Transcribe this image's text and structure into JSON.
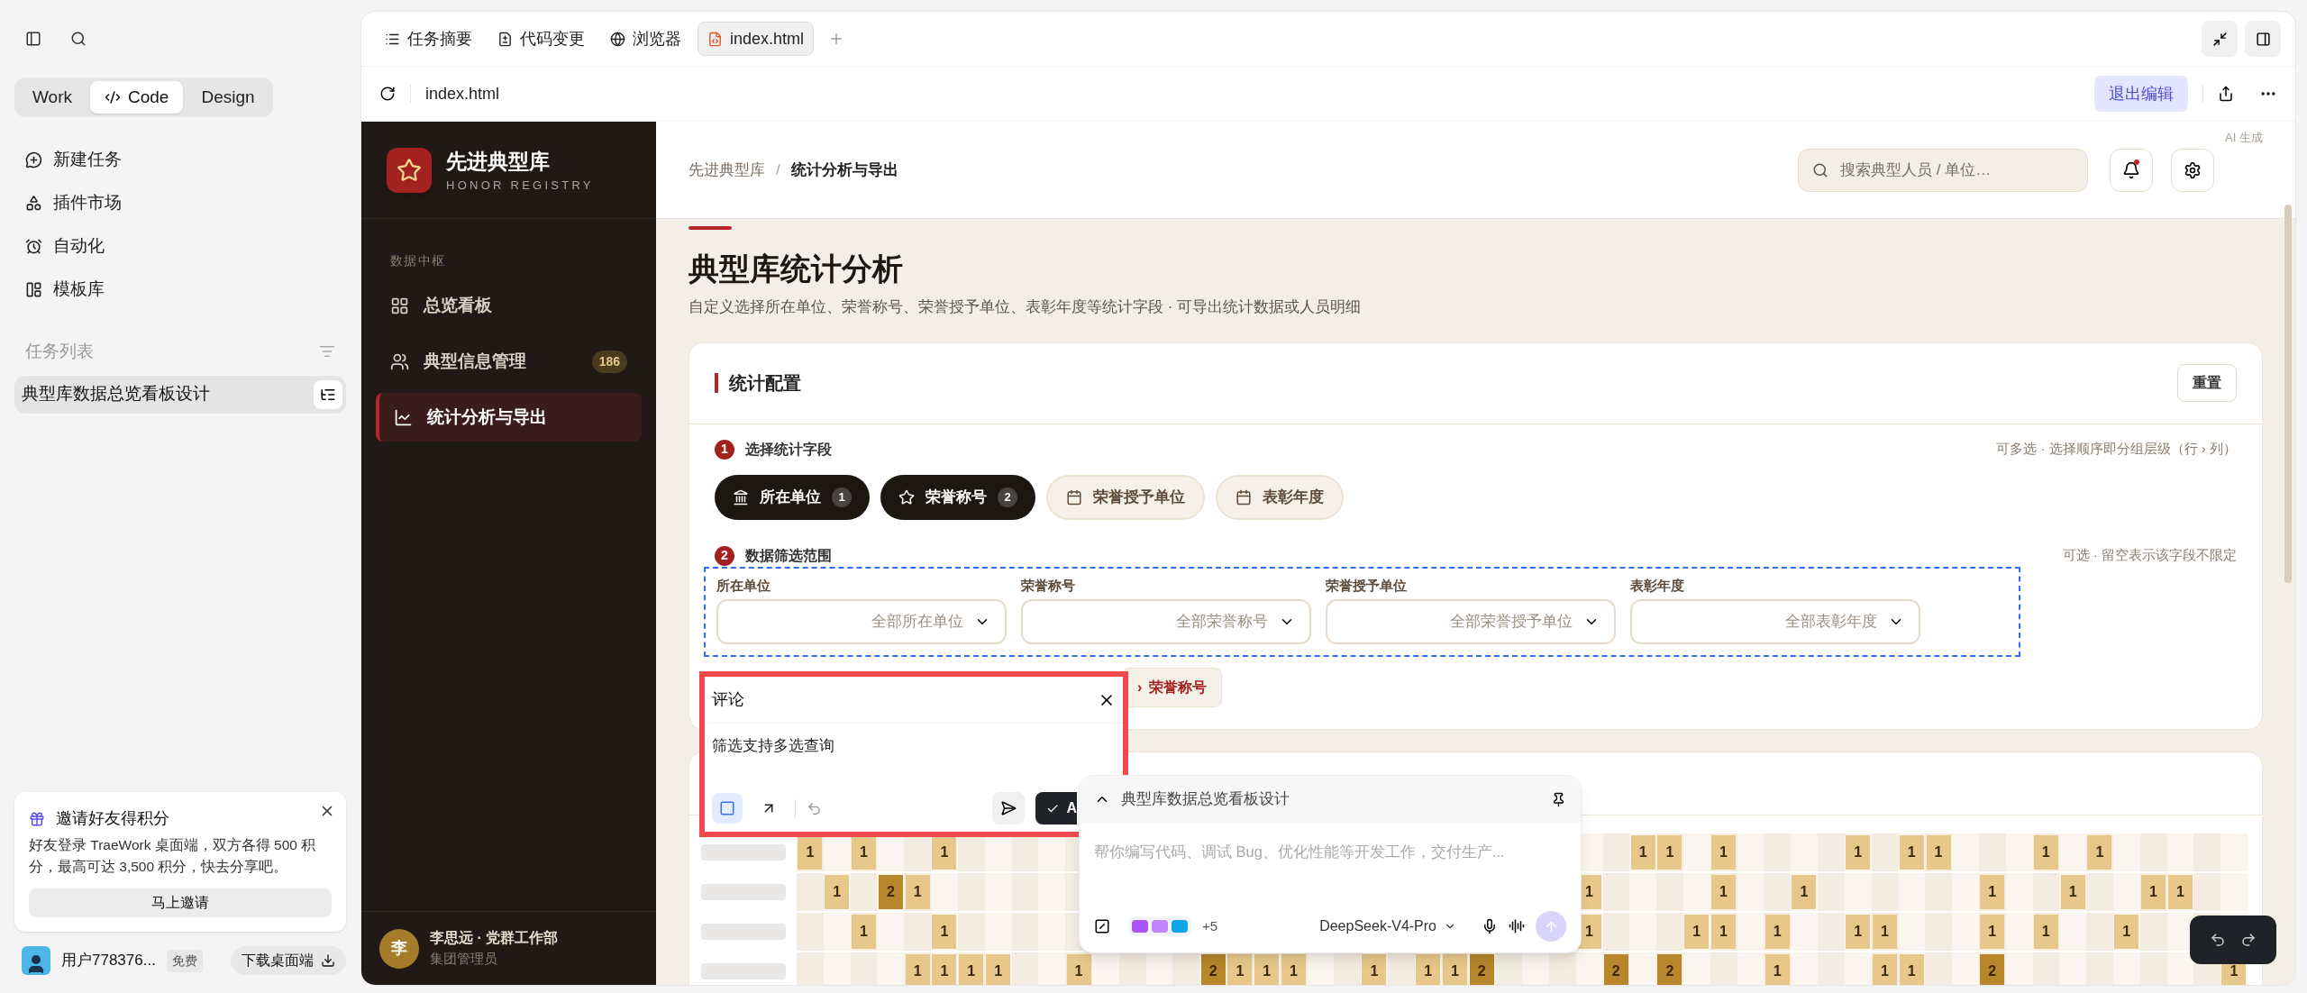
{
  "sidebar": {
    "modes": [
      {
        "label": "Work",
        "selected": false
      },
      {
        "label": "Code",
        "selected": true
      },
      {
        "label": "Design",
        "selected": false
      }
    ],
    "nav": [
      {
        "label": "新建任务"
      },
      {
        "label": "插件市场"
      },
      {
        "label": "自动化"
      },
      {
        "label": "模板库"
      }
    ],
    "task_list": {
      "title": "任务列表",
      "items": [
        {
          "label": "典型库数据总览看板设计",
          "selected": true
        }
      ]
    },
    "invite": {
      "title": "邀请好友得积分",
      "text": "好友登录 TraeWork 桌面端，双方各得 500 积分，最高可达 3,500 积分，快去分享吧。",
      "button": "马上邀请"
    },
    "user": {
      "name": "用户778376...",
      "plan": "免费",
      "download": "下载桌面端"
    }
  },
  "tabs": [
    {
      "label": "任务摘要",
      "selected": false
    },
    {
      "label": "代码变更",
      "selected": false
    },
    {
      "label": "浏览器",
      "selected": false
    },
    {
      "label": "index.html",
      "selected": true
    }
  ],
  "address": {
    "url": "index.html",
    "exit_button": "退出编辑"
  },
  "app": {
    "brand": {
      "name": "先进典型库",
      "subtitle": "HONOR REGISTRY"
    },
    "nav_section": "数据中枢",
    "nav": [
      {
        "label": "总览看板",
        "selected": false
      },
      {
        "label": "典型信息管理",
        "badge": "186",
        "selected": false
      },
      {
        "label": "统计分析与导出",
        "selected": true
      }
    ],
    "user": {
      "avatar": "李",
      "name": "李思远 · 党群工作部",
      "role": "集团管理员"
    },
    "breadcrumb": [
      "先进典型库",
      "统计分析与导出"
    ],
    "breadcrumb_separator": "/",
    "search": {
      "placeholder": "搜索典型人员 / 单位…"
    },
    "ai_note": "AI 生成",
    "title": "典型库统计分析",
    "subtitle": "自定义选择所在单位、荣誉称号、荣誉授予单位、表彰年度等统计字段 · 可导出统计数据或人员明细",
    "config": {
      "title": "统计配置",
      "reset": "重置",
      "step1": {
        "number": "1",
        "label": "选择统计字段",
        "hint": "可多选 · 选择顺序即分组层级（行 › 列）",
        "fields": [
          {
            "label": "所在单位",
            "selected": true,
            "order": "1"
          },
          {
            "label": "荣誉称号",
            "selected": true,
            "order": "2"
          },
          {
            "label": "荣誉授予单位",
            "selected": false
          },
          {
            "label": "表彰年度",
            "selected": false
          }
        ]
      },
      "step2": {
        "number": "2",
        "label": "数据筛选范围",
        "hint": "可选 · 留空表示该字段不限定",
        "filters": [
          {
            "label": "所在单位",
            "placeholder": "全部所在单位"
          },
          {
            "label": "荣誉称号",
            "placeholder": "全部荣誉称号"
          },
          {
            "label": "荣誉授予单位",
            "placeholder": "全部荣誉授予单位"
          },
          {
            "label": "表彰年度",
            "placeholder": "全部表彰年度"
          }
        ]
      },
      "group_chip": {
        "separator": "›",
        "label": "荣誉称号"
      }
    },
    "heatmap": {
      "rows": [
        [
          "1",
          null,
          "1",
          null,
          null,
          "1",
          null,
          null,
          null,
          null,
          null,
          null,
          null,
          null,
          null,
          null,
          null,
          null,
          null,
          null,
          null,
          null,
          null,
          null,
          null,
          null,
          null,
          null,
          null,
          null,
          null,
          "1",
          "1",
          null,
          "1",
          null,
          null,
          null,
          null,
          "1",
          null,
          "1",
          "1",
          null,
          null,
          null,
          "1",
          null,
          "1",
          null,
          null,
          null,
          null,
          null
        ],
        [
          null,
          "1",
          null,
          "2",
          "1",
          null,
          null,
          null,
          null,
          null,
          null,
          null,
          null,
          null,
          null,
          null,
          null,
          null,
          null,
          null,
          null,
          null,
          null,
          null,
          null,
          null,
          null,
          null,
          null,
          "1",
          null,
          null,
          null,
          null,
          "1",
          null,
          null,
          "1",
          null,
          null,
          null,
          null,
          null,
          null,
          "1",
          null,
          null,
          "1",
          null,
          null,
          "1",
          "1",
          null,
          null
        ],
        [
          null,
          null,
          "1",
          null,
          null,
          "1",
          null,
          null,
          null,
          null,
          null,
          null,
          null,
          null,
          null,
          null,
          null,
          null,
          null,
          null,
          null,
          null,
          null,
          null,
          null,
          null,
          null,
          null,
          null,
          "1",
          null,
          null,
          null,
          "1",
          "1",
          null,
          "1",
          null,
          null,
          "1",
          "1",
          null,
          null,
          null,
          "1",
          null,
          "1",
          null,
          null,
          "1",
          null,
          null,
          null,
          null
        ],
        [
          null,
          null,
          null,
          null,
          "1",
          "1",
          "1",
          "1",
          null,
          null,
          "1",
          null,
          null,
          null,
          null,
          "2",
          "1",
          "1",
          "1",
          null,
          null,
          "1",
          null,
          "1",
          "1",
          "2",
          null,
          null,
          null,
          null,
          "2",
          null,
          "2",
          null,
          null,
          null,
          "1",
          null,
          null,
          null,
          "1",
          "1",
          null,
          null,
          "2",
          null,
          null,
          null,
          null,
          null,
          null,
          null,
          null,
          "1"
        ]
      ]
    }
  },
  "comment": {
    "title": "评论",
    "text": "筛选支持多选查询",
    "tools": [
      {
        "selected": true
      },
      {
        "selected": false
      }
    ],
    "confirm": "A"
  },
  "chat": {
    "task": "典型库数据总览看板设计",
    "placeholder": "帮你编写代码、调试 Bug、优化性能等开发工作，交付生产...",
    "more": "+5",
    "model": "DeepSeek-V4-Pro"
  }
}
